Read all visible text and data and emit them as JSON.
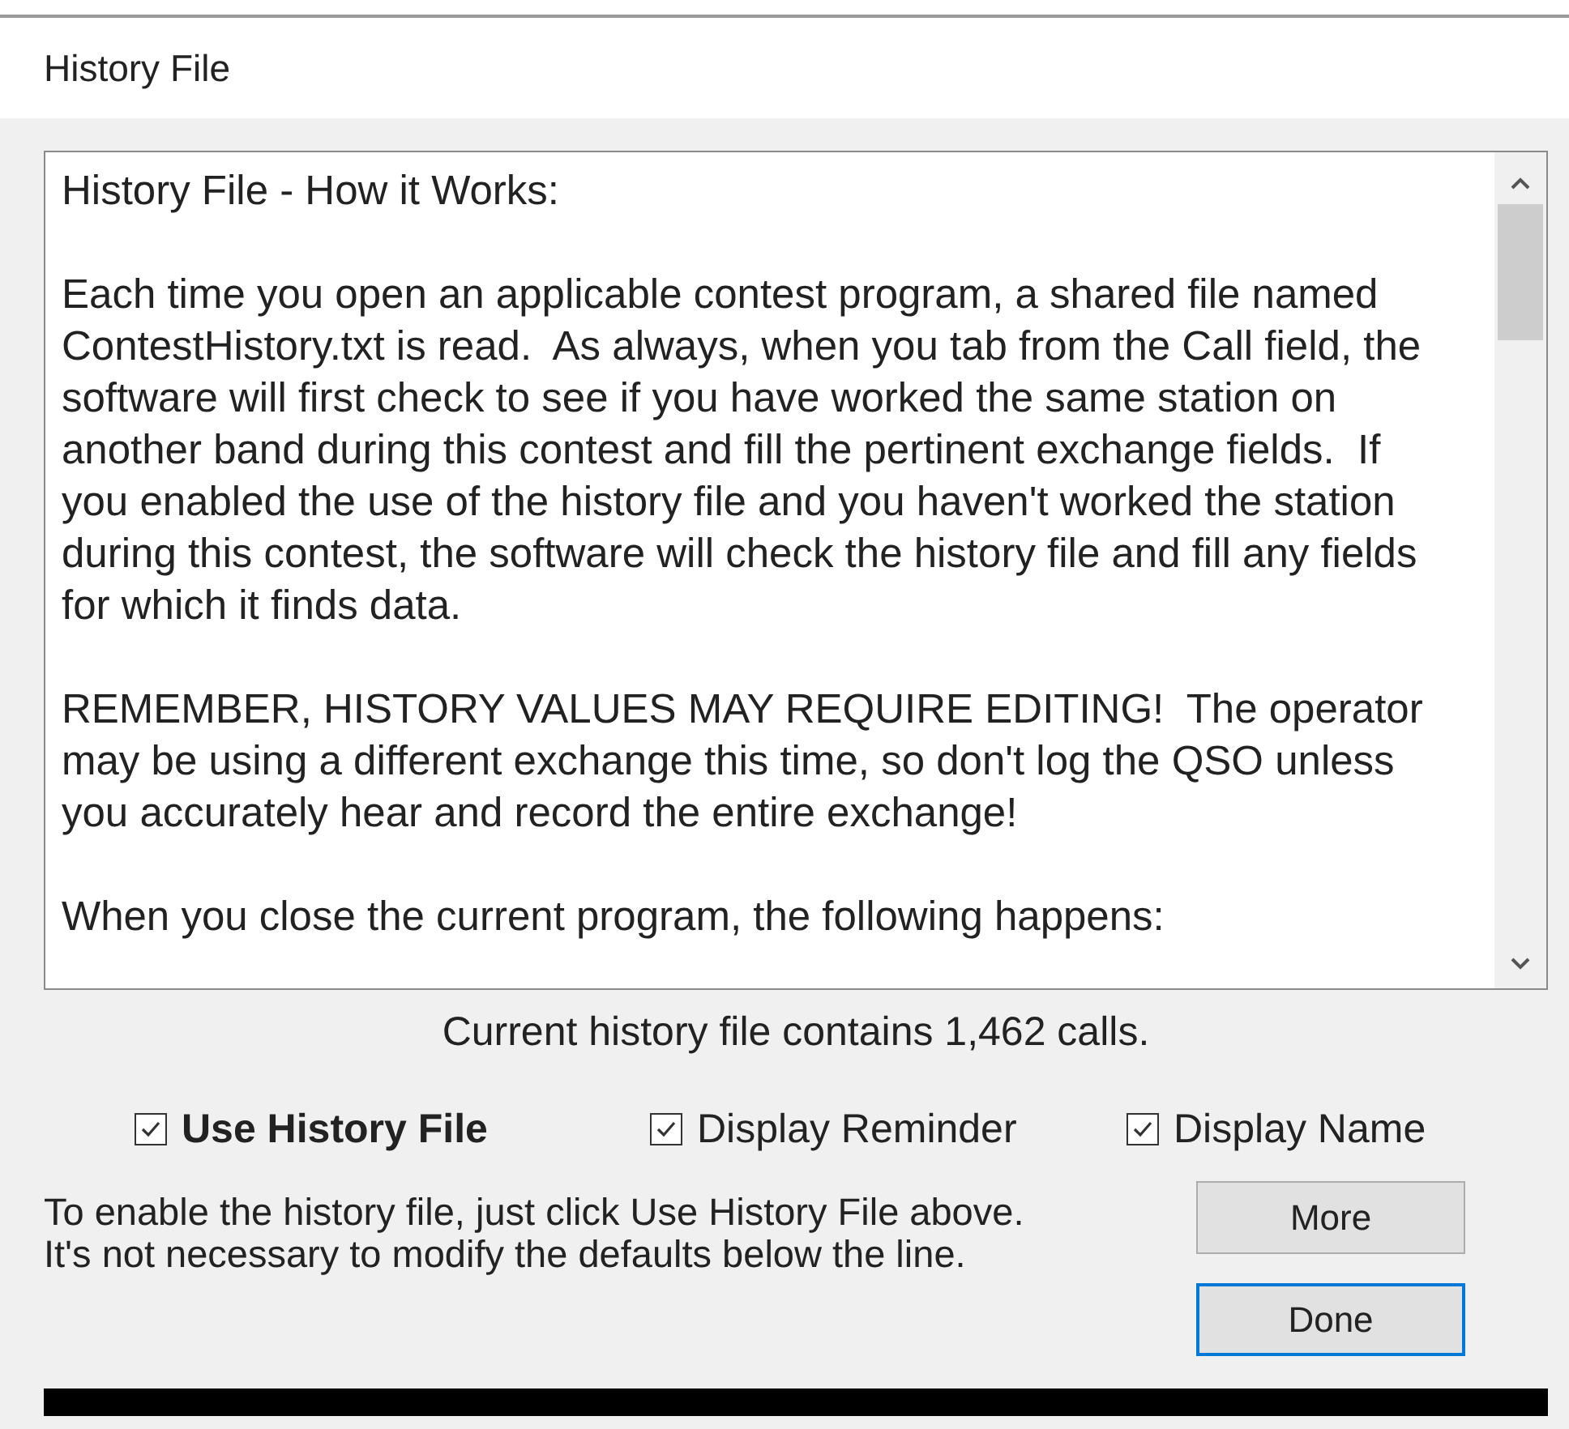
{
  "window": {
    "title": "History File"
  },
  "text_box": {
    "paragraphs": [
      [
        "History File - How it Works:"
      ],
      [
        "Each time you open an applicable contest program, a shared file named",
        "ContestHistory.txt is read.  As always, when you tab from the Call field, the",
        "software will first check to see if you have worked the same station on",
        "another band during this contest and fill the pertinent exchange fields.  If",
        "you enabled the use of the history file and you haven't worked the station",
        "during this contest, the software will check the history file and fill any fields",
        "for which it finds data."
      ],
      [
        "REMEMBER, HISTORY VALUES MAY REQUIRE EDITING!  The operator",
        "may be using a different exchange this time, so don't log the QSO unless",
        "you accurately hear and record the entire exchange!"
      ],
      [
        "When you close the current program, the following happens:"
      ]
    ]
  },
  "status": "Current history file contains 1,462 calls.",
  "options": [
    {
      "label": "Use History File",
      "checked": true,
      "bold": true
    },
    {
      "label": "Display Reminder",
      "checked": true,
      "bold": false
    },
    {
      "label": "Display Name",
      "checked": true,
      "bold": false
    }
  ],
  "hint": [
    "To enable the history file, just click Use History File above.",
    "It's not necessary to modify the defaults below the line."
  ],
  "buttons": [
    {
      "label": "More",
      "focused": false
    },
    {
      "label": "Done",
      "focused": true
    }
  ]
}
